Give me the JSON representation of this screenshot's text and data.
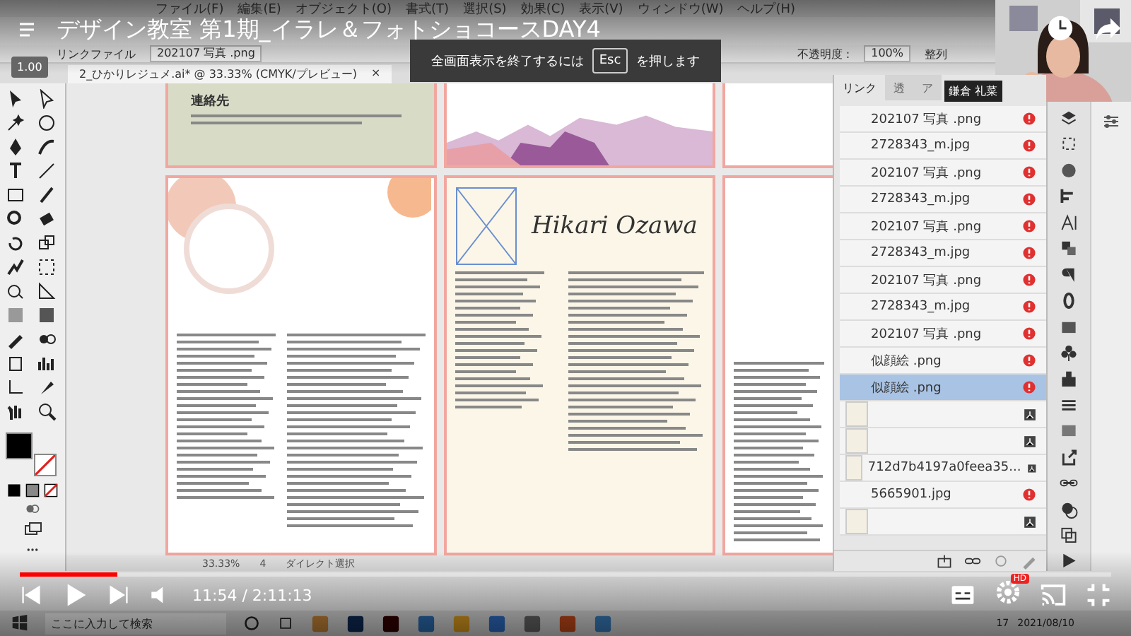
{
  "video": {
    "title": "デザイン教室 第1期_イラレ＆フォトショコースDAY4",
    "speed": "1.00",
    "time": "11:54 / 2:11:13",
    "level": 0.09,
    "hd_badge": "HD"
  },
  "fullscreen_notice": {
    "before": "全画面表示を終了するには",
    "key": "Esc",
    "after": "を押します"
  },
  "presenter": {
    "name": "鎌倉 礼菜"
  },
  "illustrator": {
    "menu": [
      "ファイル(F)",
      "編集(E)",
      "オブジェクト(O)",
      "書式(T)",
      "選択(S)",
      "効果(C)",
      "表示(V)",
      "ウィンドウ(W)",
      "ヘルプ(H)"
    ],
    "control_bar": {
      "label": "リンクファイル",
      "file": "202107 写真 .png",
      "opacity_label": "不透明度 :",
      "opacity": "100%",
      "align": "整列"
    },
    "document_tab": {
      "title": "2_ひかりレジュメ.ai* @ 33.33% (CMYK/プレビュー)",
      "close": "×"
    },
    "artboard_texts": {
      "contact": "連絡先",
      "name": "Hikari Ozawa"
    },
    "links_panel": {
      "tabs": [
        {
          "label": "リンク",
          "selected": true
        },
        {
          "label": "透",
          "selected": false
        },
        {
          "label": "ア",
          "selected": false
        }
      ],
      "rows": [
        {
          "name": "202107 写真 .png",
          "kind": "missing",
          "selected": false,
          "thumbnail": false
        },
        {
          "name": "2728343_m.jpg",
          "kind": "missing",
          "selected": false,
          "thumbnail": false
        },
        {
          "name": "202107 写真 .png",
          "kind": "missing",
          "selected": false,
          "thumbnail": false
        },
        {
          "name": "2728343_m.jpg",
          "kind": "missing",
          "selected": false,
          "thumbnail": false
        },
        {
          "name": "202107 写真 .png",
          "kind": "missing",
          "selected": false,
          "thumbnail": false
        },
        {
          "name": "2728343_m.jpg",
          "kind": "missing",
          "selected": false,
          "thumbnail": false
        },
        {
          "name": "202107 写真 .png",
          "kind": "missing",
          "selected": false,
          "thumbnail": false
        },
        {
          "name": "2728343_m.jpg",
          "kind": "missing",
          "selected": false,
          "thumbnail": false
        },
        {
          "name": "202107 写真 .png",
          "kind": "missing",
          "selected": false,
          "thumbnail": false
        },
        {
          "name": "似顔絵 .png",
          "kind": "missing",
          "selected": false,
          "thumbnail": false
        },
        {
          "name": "似顔絵 .png",
          "kind": "missing",
          "selected": true,
          "thumbnail": false
        },
        {
          "kind": "embedded",
          "selected": false,
          "thumbnail": true
        },
        {
          "kind": "embedded",
          "selected": false,
          "thumbnail": true
        },
        {
          "name": "712d7b4197a0feea35...",
          "kind": "embedded",
          "selected": false,
          "thumbnail": true
        },
        {
          "name": "5665901.jpg",
          "kind": "missing",
          "selected": false,
          "thumbnail": false
        },
        {
          "kind": "embedded",
          "selected": false,
          "thumbnail": true
        }
      ]
    },
    "status_bar": {
      "zoom": "33.33%",
      "artboard": "4",
      "tool": "ダイレクト選択"
    }
  },
  "taskbar": {
    "search_placeholder": "ここに入力して検索",
    "time": "17",
    "date": "2021/08/10"
  }
}
